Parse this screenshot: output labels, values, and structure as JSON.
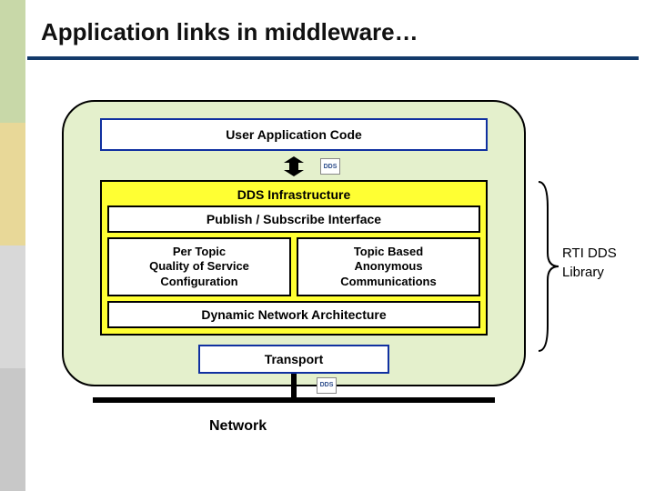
{
  "title": "Application links in middleware…",
  "diagram": {
    "user_app": "User Application Code",
    "dds_title": "DDS Infrastructure",
    "pubsub": "Publish / Subscribe Interface",
    "qos": "Per Topic\nQuality of Service\nConfiguration",
    "topic": "Topic Based\nAnonymous\nCommunications",
    "dynamic": "Dynamic Network Architecture",
    "transport": "Transport",
    "network": "Network",
    "mini_logo": "DDS"
  },
  "brace": {
    "line1": "RTI DDS",
    "line2": "Library"
  }
}
